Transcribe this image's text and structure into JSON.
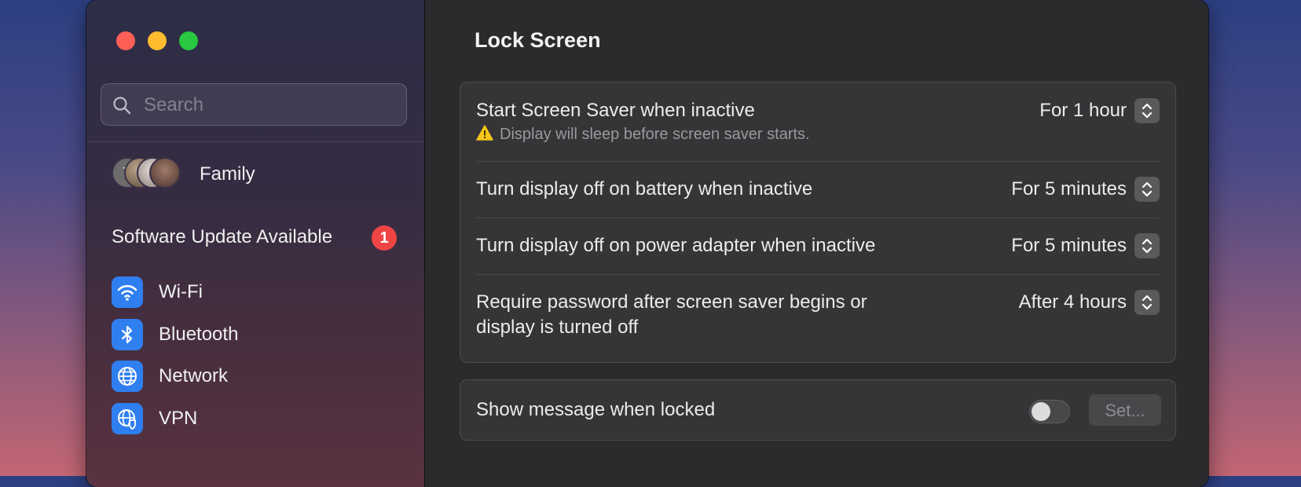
{
  "window": {
    "traffic_lights": [
      "close",
      "minimize",
      "zoom"
    ]
  },
  "sidebar": {
    "search_placeholder": "Search",
    "family": {
      "avatar_initial": "T",
      "label": "Family"
    },
    "software_update": {
      "label": "Software Update Available",
      "badge_count": "1"
    },
    "items": [
      {
        "label": "Wi-Fi",
        "icon": "wifi-icon"
      },
      {
        "label": "Bluetooth",
        "icon": "bluetooth-icon"
      },
      {
        "label": "Network",
        "icon": "globe-icon"
      },
      {
        "label": "VPN",
        "icon": "vpn-globe-shield-icon"
      }
    ]
  },
  "main": {
    "title": "Lock Screen",
    "settings": [
      {
        "label": "Start Screen Saver when inactive",
        "sublabel": "Display will sleep before screen saver starts.",
        "value": "For 1 hour"
      },
      {
        "label": "Turn display off on battery when inactive",
        "value": "For 5 minutes"
      },
      {
        "label": "Turn display off on power adapter when inactive",
        "value": "For 5 minutes"
      },
      {
        "label_line1": "Require password after screen saver begins or",
        "label_line2": "display is turned off",
        "value": "After 4 hours"
      }
    ],
    "message": {
      "label": "Show message when locked",
      "toggle_on": false,
      "set_button": "Set..."
    }
  },
  "colors": {
    "accent_blue": "#2f7ff0",
    "badge_red": "#ef4545",
    "warning_yellow": "#f5c518"
  }
}
